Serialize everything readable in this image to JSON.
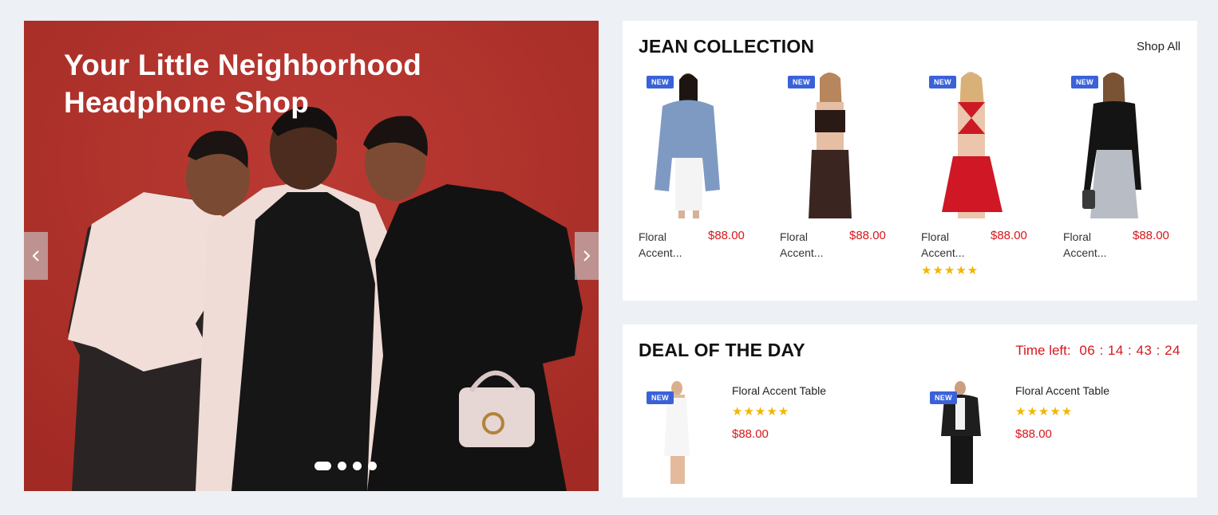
{
  "hero": {
    "title": "Your Little Neighborhood Headphone Shop",
    "prev_icon": "chevron-left-icon",
    "next_icon": "chevron-right-icon",
    "dots": 4,
    "active_dot": 1
  },
  "jean": {
    "title": "JEAN COLLECTION",
    "shop_all": "Shop All",
    "products": [
      {
        "badge": "NEW",
        "name": "Floral Accent...",
        "price": "$88.00",
        "rating": 0,
        "image": "model-blue-jacket"
      },
      {
        "badge": "NEW",
        "name": "Floral Accent...",
        "price": "$88.00",
        "rating": 0,
        "image": "model-brown-satin"
      },
      {
        "badge": "NEW",
        "name": "Floral Accent...",
        "price": "$88.00",
        "rating": 5,
        "stars": "★★★★★",
        "image": "model-red-halter"
      },
      {
        "badge": "NEW",
        "name": "Floral Accent...",
        "price": "$88.00",
        "rating": 0,
        "image": "model-black-top-silver-skirt"
      }
    ]
  },
  "deal": {
    "title": "DEAL OF THE DAY",
    "time_label": "Time left:",
    "time_value": "06 : 14 : 43 : 24",
    "items": [
      {
        "badge": "NEW",
        "name": "Floral Accent Table",
        "stars": "★★★★★",
        "rating": 5,
        "price": "$88.00",
        "image": "model-white-dress"
      },
      {
        "badge": "NEW",
        "name": "Floral Accent Table",
        "stars": "★★★★★",
        "rating": 5,
        "price": "$88.00",
        "image": "model-black-puffer"
      }
    ]
  },
  "colors": {
    "accent_red": "#d8161b",
    "badge_blue": "#3a62d8",
    "hero_bg": "#b0332d",
    "star": "#f2b600"
  }
}
